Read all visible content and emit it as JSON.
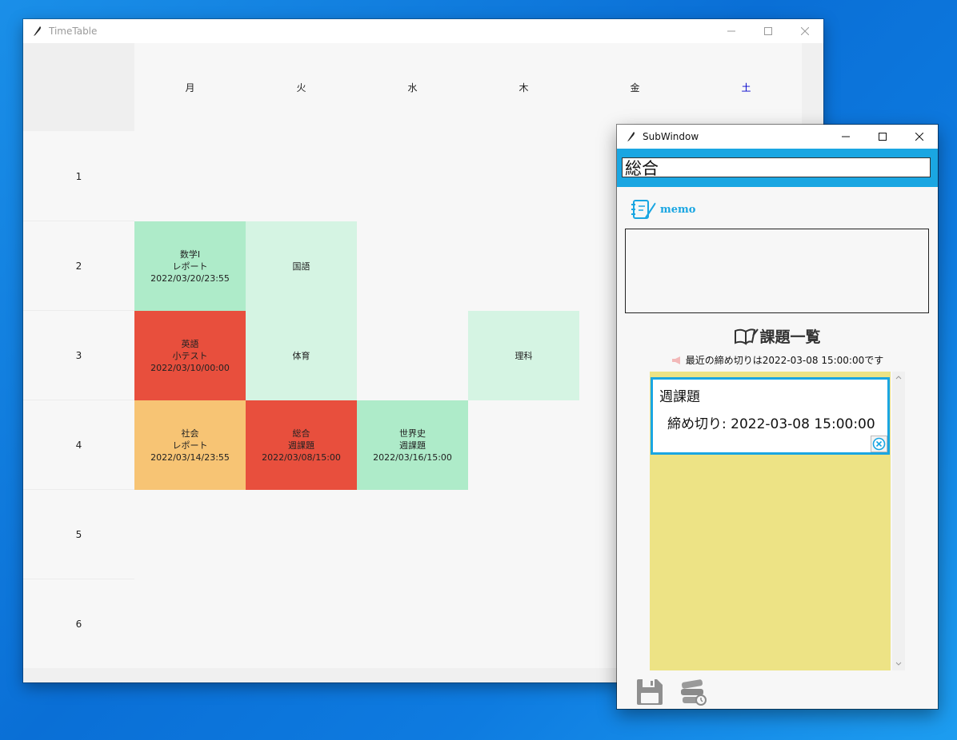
{
  "main_window": {
    "title": "TimeTable",
    "days": [
      "月",
      "火",
      "水",
      "木",
      "金",
      "土"
    ],
    "periods": [
      "1",
      "2",
      "3",
      "4",
      "5",
      "6"
    ],
    "colors": {
      "done": "#aeebc9",
      "light": "#d5f4e3",
      "urgent": "#e84f3d",
      "warning": "#f7c474"
    },
    "cells": [
      {
        "period": "2",
        "day": "月",
        "status": "done",
        "lines": [
          "数学Ⅰ",
          "レポート",
          "2022/03/20/23:55"
        ]
      },
      {
        "period": "2",
        "day": "火",
        "status": "light",
        "lines": [
          "国語"
        ]
      },
      {
        "period": "3",
        "day": "月",
        "status": "urgent",
        "lines": [
          "英語",
          "小テスト",
          "2022/03/10/00:00"
        ]
      },
      {
        "period": "3",
        "day": "火",
        "status": "light",
        "lines": [
          "体育"
        ]
      },
      {
        "period": "3",
        "day": "木",
        "status": "light",
        "lines": [
          "理科"
        ]
      },
      {
        "period": "4",
        "day": "月",
        "status": "warning",
        "lines": [
          "社会",
          "レポート",
          "2022/03/14/23:55"
        ]
      },
      {
        "period": "4",
        "day": "火",
        "status": "urgent",
        "lines": [
          "総合",
          "週課題",
          "2022/03/08/15:00"
        ]
      },
      {
        "period": "4",
        "day": "水",
        "status": "done",
        "lines": [
          "世界史",
          "週課題",
          "2022/03/16/15:00"
        ]
      }
    ]
  },
  "sub_window": {
    "title": "SubWindow",
    "subject_value": "総合",
    "memo_label": "memo",
    "memo_text": "",
    "task_list_heading": "課題一覧",
    "deadline_notice": "最近の締め切りは2022-03-08 15:00:00です",
    "tasks": [
      {
        "name": "週課題",
        "deadline": "締め切り: 2022-03-08 15:00:00"
      }
    ],
    "accent_color": "#1aa6e2",
    "task_area_color": "#ede385",
    "icons": [
      "memo-icon",
      "book-icon",
      "megaphone-icon",
      "close-circle-icon",
      "save-icon",
      "books-icon"
    ]
  }
}
